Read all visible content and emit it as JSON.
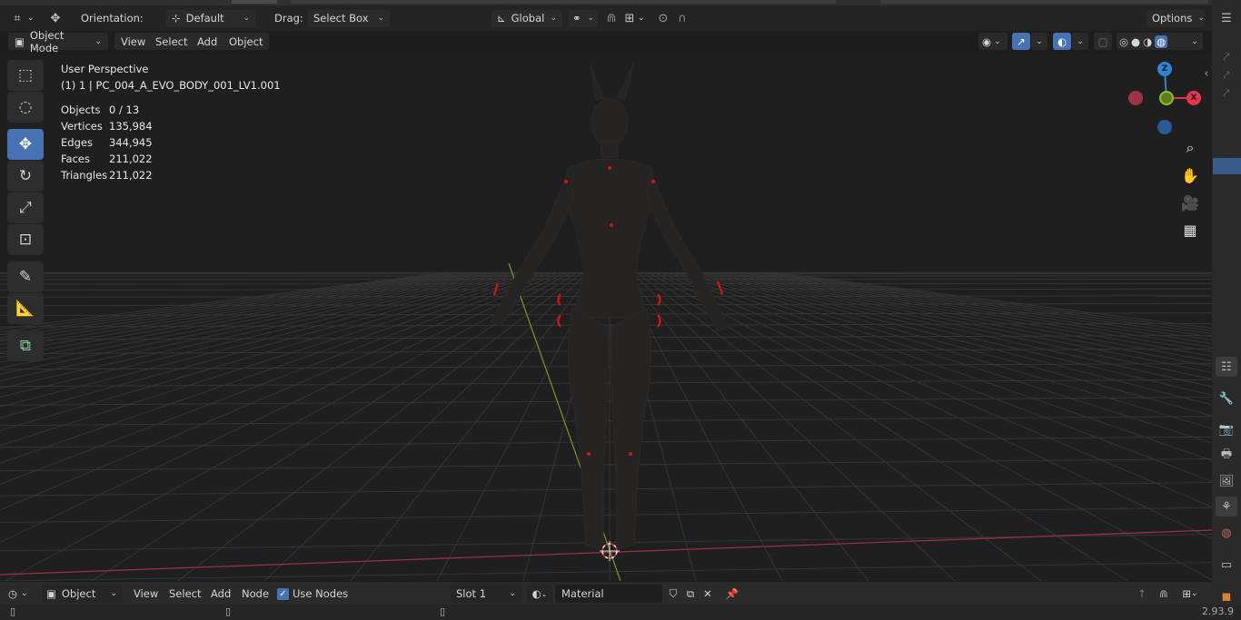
{
  "header": {
    "orientation_label": "Orientation:",
    "orientation_value": "Default",
    "drag_label": "Drag:",
    "drag_value": "Select Box",
    "transform_space": "Global",
    "options_label": "Options"
  },
  "mode_bar": {
    "mode": "Object Mode",
    "menus": [
      "View",
      "Select",
      "Add",
      "Object"
    ]
  },
  "viewport": {
    "view_name": "User Perspective",
    "active_object": "(1) 1 | PC_004_A_EVO_BODY_001_LV1.001",
    "stats": [
      {
        "label": "Objects",
        "value": "0 / 13"
      },
      {
        "label": "Vertices",
        "value": "135,984"
      },
      {
        "label": "Edges",
        "value": "344,945"
      },
      {
        "label": "Faces",
        "value": "211,022"
      },
      {
        "label": "Triangles",
        "value": "211,022"
      }
    ],
    "gizmo": {
      "z": "Z",
      "x": "X",
      "colors": {
        "x": "#e5354b",
        "y": "#8cbd2c",
        "z": "#2f83d8"
      }
    }
  },
  "toolbar": {
    "tools": [
      "select-box",
      "cursor",
      "move",
      "rotate",
      "scale",
      "transform",
      "annotate",
      "measure",
      "add-cube"
    ],
    "active": "move"
  },
  "bottom_bar": {
    "editor_mode": "Object",
    "menus": [
      "View",
      "Select",
      "Add",
      "Node"
    ],
    "use_nodes_label": "Use Nodes",
    "use_nodes_checked": true,
    "slot": "Slot 1",
    "material": "Material"
  },
  "status": {
    "version": "2.93.9"
  },
  "colors": {
    "accent": "#4772b3",
    "header_bg": "#242424",
    "viewport_bg": "#1d1d1d",
    "grid_line": "#3a3a3a",
    "x_axis": "#a0303c",
    "y_axis": "#7a9a2a",
    "emissive": "#e01010"
  }
}
